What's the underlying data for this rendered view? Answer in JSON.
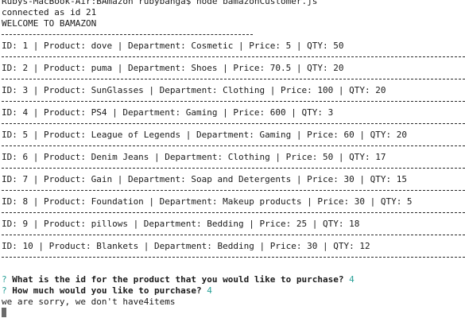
{
  "terminal": {
    "prompt_line": "Rubys-MacBook-Air:BAmazon rubybanga$ node bamazonCustomer.js",
    "connected": "connected as id 21",
    "welcome": "WELCOME TO BAMAZON",
    "products": [
      "ID: 1 | Product: dove | Department: Cosmetic | Price: 5 | QTY: 50",
      "ID: 2 | Product: puma | Department: Shoes | Price: 70.5 | QTY: 20",
      "ID: 3 | Product: SunGlasses | Department: Clothing | Price: 100 | QTY: 20",
      "ID: 4 | Product: PS4 | Department: Gaming | Price: 600 | QTY: 3",
      "ID: 5 | Product: League of Legends | Department: Gaming | Price: 60 | QTY: 20",
      "ID: 6 | Product: Denim Jeans | Department: Clothing | Price: 50 | QTY: 17",
      "ID: 7 | Product: Gain | Department: Soap and Detergents | Price: 30 | QTY: 15",
      "ID: 8 | Product: Foundation | Department: Makeup products | Price: 30 | QTY: 5",
      "ID: 9 | Product: pillows | Department: Bedding | Price: 25 | QTY: 18",
      "ID: 10 | Product: Blankets | Department: Bedding | Price: 30 | QTY: 12"
    ],
    "prompts": [
      {
        "mark": "?",
        "question": "What is the id for the product that you would like to purchase?",
        "answer": "4"
      },
      {
        "mark": "?",
        "question": "How much would you like to purchase?",
        "answer": "4"
      }
    ],
    "result": "we are sorry, we don't have4items",
    "colors": {
      "background": "#ffffff",
      "text": "#1a1a1a",
      "inquirer_accent": "#2aa198"
    }
  }
}
